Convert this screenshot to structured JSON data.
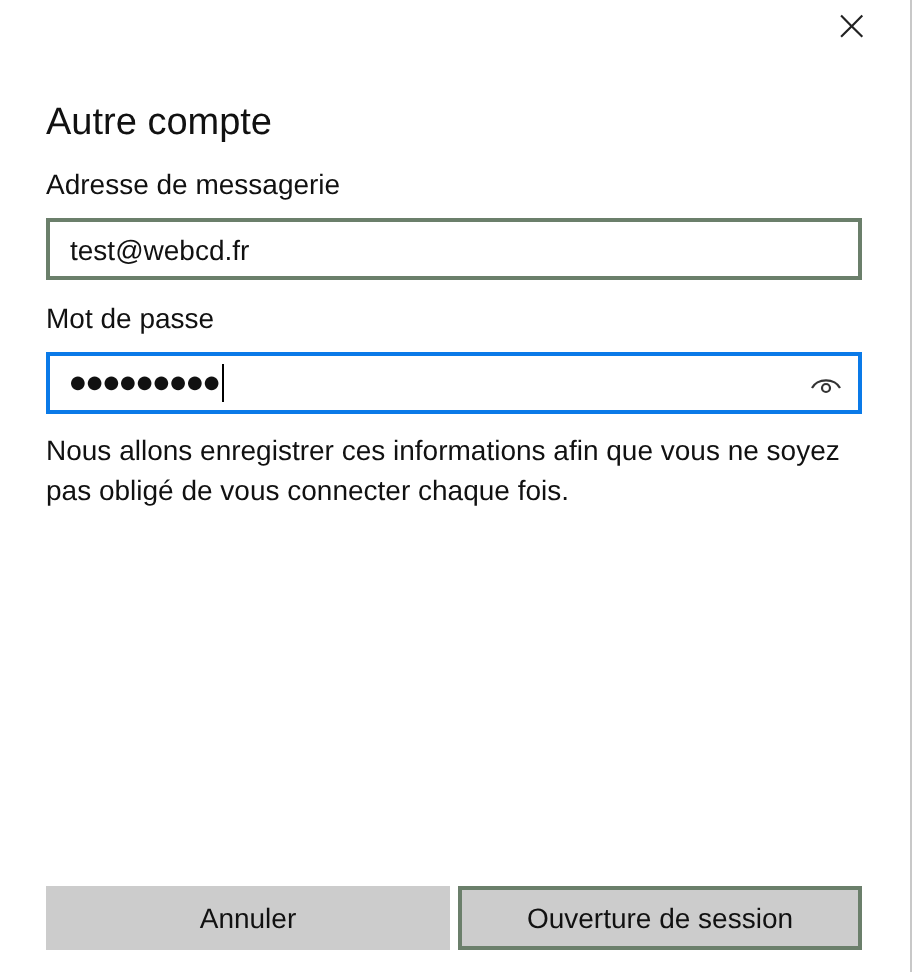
{
  "close_symbol": "×",
  "title": "Autre compte",
  "fields": [
    {
      "label": "Adresse de messagerie",
      "value": "test@webcd.fr",
      "kind": "text",
      "focused": false
    },
    {
      "label": "Mot de passe",
      "value": "●●●●●●●●●",
      "kind": "password",
      "focused": true
    }
  ],
  "note": "Nous allons enregistrer ces informations afin que vous ne soyez pas obligé de vous connecter chaque fois.",
  "buttons": [
    {
      "label": "Annuler",
      "default": false
    },
    {
      "label": "Ouverture de session",
      "default": true
    }
  ]
}
